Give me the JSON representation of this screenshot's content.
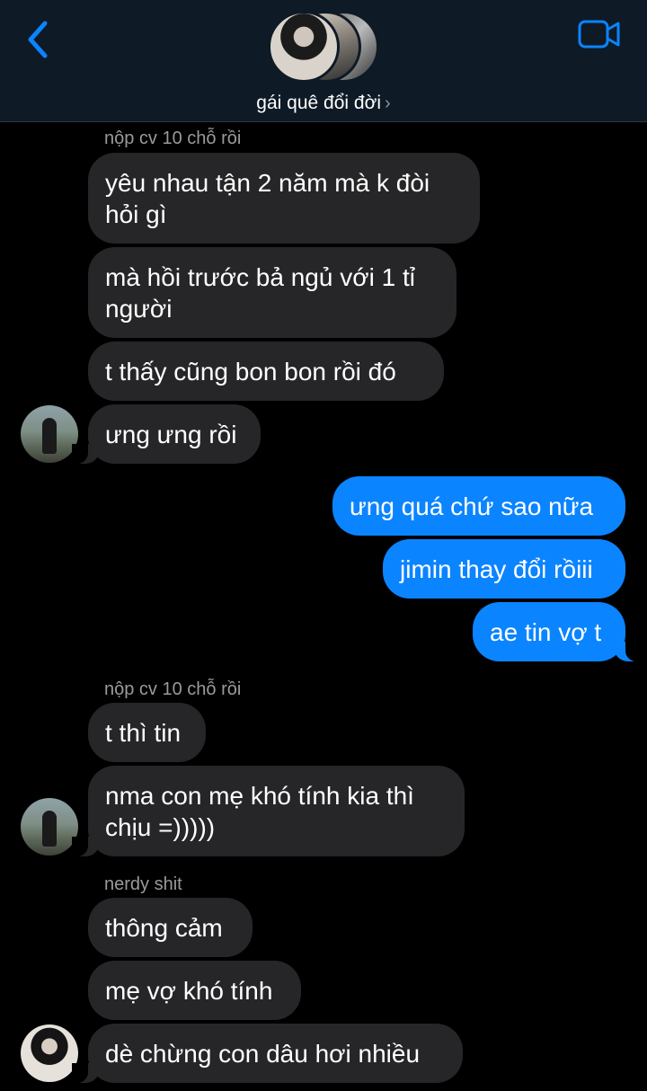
{
  "header": {
    "group_name": "gái quê đổi đời",
    "chevron": "›",
    "back_icon": "chevron-left-icon",
    "video_icon": "video-camera-icon",
    "accent": "#0b84ff"
  },
  "messages": [
    {
      "sender": "nộp cv 10 chỗ rồi"
    },
    {
      "text": "yêu nhau tận 2 năm mà k đòi\nhỏi gì"
    },
    {
      "text": "mà hồi trước bả ngủ với 1 tỉ\nngười"
    },
    {
      "text": "t thấy cũng bon bon rồi đó"
    },
    {
      "text": "ưng ưng rồi"
    },
    {
      "text": "ưng quá chứ sao nữa"
    },
    {
      "text": "jimin thay đổi rồiii"
    },
    {
      "text": "ae tin vợ t"
    },
    {
      "sender": "nộp cv 10 chỗ rồi"
    },
    {
      "text": "t thì tin"
    },
    {
      "text": "nma con mẹ khó tính kia thì\nchịu =)))))"
    },
    {
      "sender": "nerdy shit"
    },
    {
      "text": "thông cảm"
    },
    {
      "text": "mẹ vợ khó tính"
    },
    {
      "text": "dè chừng con dâu hơi nhiều"
    }
  ],
  "colors": {
    "incoming_bubble": "#262628",
    "outgoing_bubble": "#0b84ff",
    "header_bg": "#0e1a26"
  }
}
